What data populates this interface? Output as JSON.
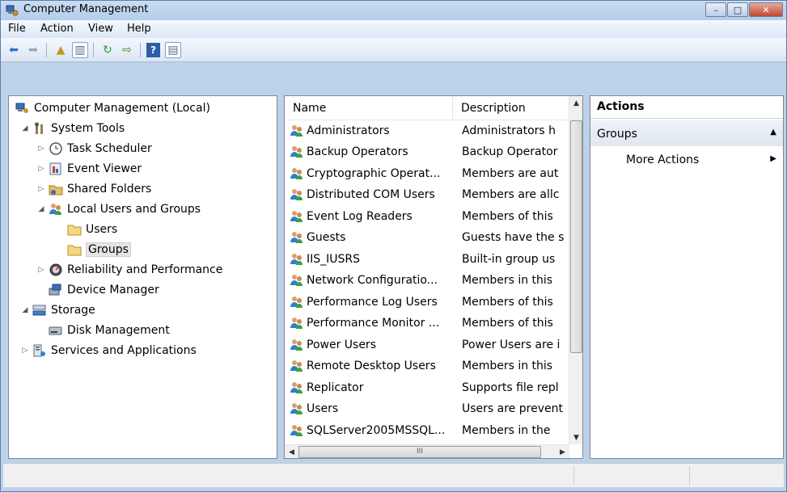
{
  "window": {
    "title": "Computer Management"
  },
  "caption_buttons": [
    "–",
    "□",
    "✕"
  ],
  "menu": [
    {
      "label": "File"
    },
    {
      "label": "Action"
    },
    {
      "label": "View"
    },
    {
      "label": "Help"
    }
  ],
  "tree": {
    "items": [
      {
        "label": "Computer Management (Local)"
      },
      {
        "label": "System Tools"
      },
      {
        "label": "Task Scheduler"
      },
      {
        "label": "Event Viewer"
      },
      {
        "label": "Shared Folders"
      },
      {
        "label": "Local Users and Groups"
      },
      {
        "label": "Users"
      },
      {
        "label": "Groups"
      },
      {
        "label": "Reliability and Performance"
      },
      {
        "label": "Device Manager"
      },
      {
        "label": "Storage"
      },
      {
        "label": "Disk Management"
      },
      {
        "label": "Services and Applications"
      }
    ]
  },
  "list": {
    "columns": [
      "Name",
      "Description"
    ],
    "rows": [
      {
        "name": "Administrators",
        "desc": "Administrators h"
      },
      {
        "name": "Backup Operators",
        "desc": "Backup Operator"
      },
      {
        "name": "Cryptographic Operat...",
        "desc": "Members are aut"
      },
      {
        "name": "Distributed COM Users",
        "desc": "Members are allc"
      },
      {
        "name": "Event Log Readers",
        "desc": "Members of this"
      },
      {
        "name": "Guests",
        "desc": "Guests have the s"
      },
      {
        "name": "IIS_IUSRS",
        "desc": "Built-in group us"
      },
      {
        "name": "Network Configuratio...",
        "desc": "Members in this"
      },
      {
        "name": "Performance Log Users",
        "desc": "Members of this"
      },
      {
        "name": "Performance Monitor ...",
        "desc": "Members of this"
      },
      {
        "name": "Power Users",
        "desc": "Power Users are i"
      },
      {
        "name": "Remote Desktop Users",
        "desc": "Members in this"
      },
      {
        "name": "Replicator",
        "desc": "Supports file repl"
      },
      {
        "name": "Users",
        "desc": "Users are prevent"
      },
      {
        "name": "SQLServer2005MSSQL...",
        "desc": "Members in the"
      }
    ],
    "hscroll_grip": "III"
  },
  "actions": {
    "header": "Actions",
    "section": "Groups",
    "item": "More Actions"
  }
}
